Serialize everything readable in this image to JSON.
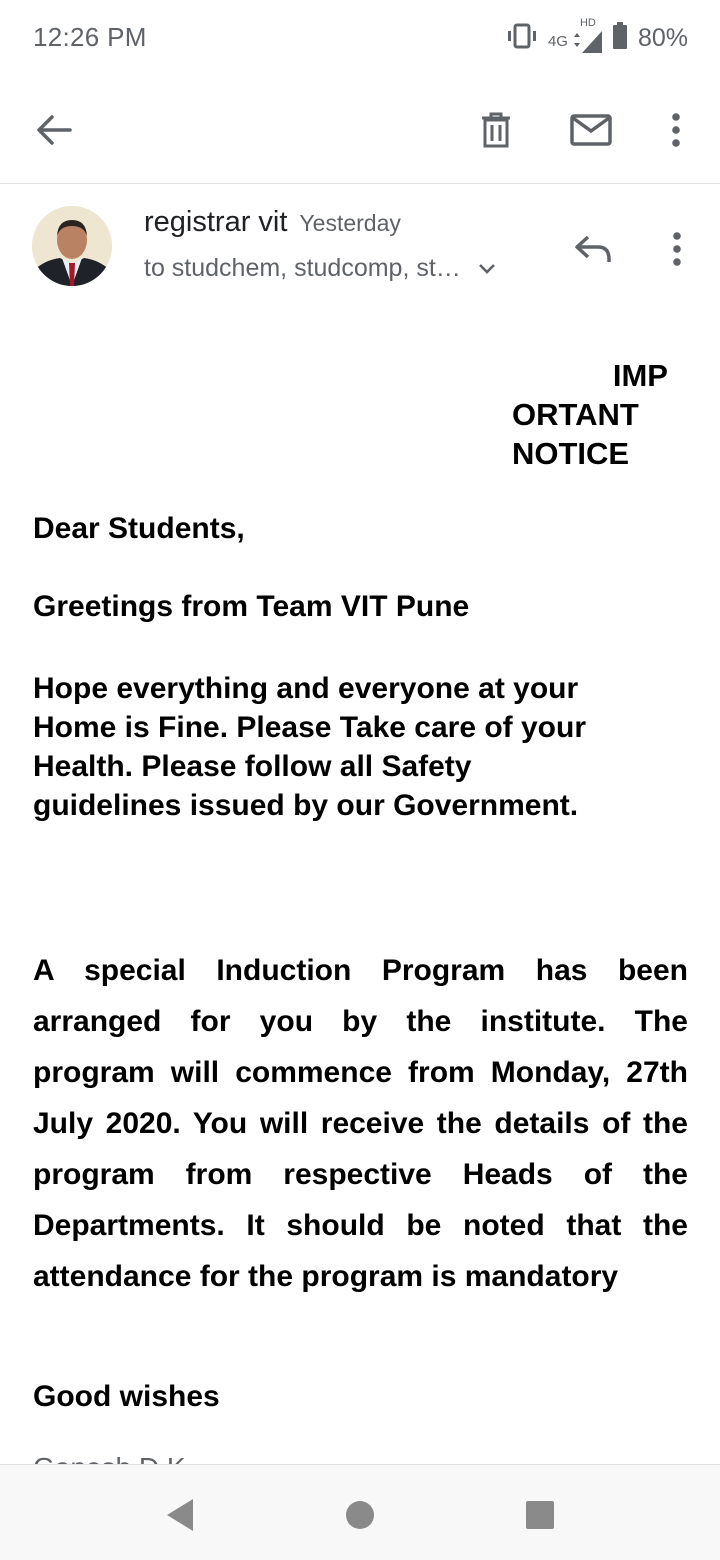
{
  "status_bar": {
    "time": "12:26 PM",
    "network_hd": "HD",
    "network_type": "4G",
    "battery": "80%",
    "icons": [
      "vibrate-icon",
      "signal-icon",
      "battery-icon"
    ]
  },
  "app_bar": {
    "icons": [
      "back-arrow-icon",
      "delete-icon",
      "mark-unread-icon",
      "more-vert-icon"
    ]
  },
  "message": {
    "sender": "registrar vit",
    "date": "Yesterday",
    "recipients": "to studchem, studcomp, st…",
    "notice": {
      "line1": "IMP",
      "line2": "ORTANT",
      "line3": "NOTICE"
    },
    "greeting": "Dear Students,",
    "greeting_team": "Greetings from Team VIT Pune",
    "hope": "Hope everything and everyone at your Home is Fine. Please Take care of your Health. Please follow all Safety guidelines issued by our Government.",
    "special": "A special Induction Program has been arranged for you by the institute. The program will commence from Monday, 27th July 2020. You will receive the details of the program from respective Heads of the Departments. It should be noted that the attendance for the program is mandatory",
    "wishes": "Good wishes",
    "signature_partial": "Ganesh D K"
  },
  "nav_bar": {
    "icons": [
      "nav-back-icon",
      "nav-home-icon",
      "nav-recents-icon"
    ]
  }
}
